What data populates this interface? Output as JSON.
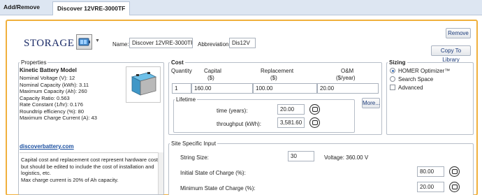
{
  "tab": {
    "label": "Add/Remove",
    "active": "Discover 12VRE-3000TF"
  },
  "header": {
    "title": "STORAGE",
    "name_label": "Name:",
    "name_value": "Discover 12VRE-3000TF",
    "abbr_label": "Abbreviation:",
    "abbr_value": "Dis12V",
    "remove_label": "Remove",
    "library_label": "Copy To Library"
  },
  "properties": {
    "title": "Properties",
    "model": "Kinetic Battery Model",
    "lines": [
      "Nominal Voltage (V): 12",
      "Nominal Capacity (kWh): 3.11",
      "Maximum Capacity (Ah): 260",
      "Capacity Ratio: 0.563",
      "Rate Constant (1/hr): 0.176",
      "Roundtrip efficiency (%): 80",
      "Maximum Charge Current (A): 43"
    ],
    "link": "discoverbattery.com",
    "note_lines": [
      "Capital cost and replacement cost represent hardware costs,",
      "but should be edited to include the cost of installation and",
      "logistics, etc.",
      "Max charge current is 20% of Ah capacity."
    ]
  },
  "cost": {
    "title": "Cost",
    "headers": {
      "quantity": "Quantity",
      "capital": "Capital",
      "capital_unit": "($)",
      "replacement": "Replacement",
      "replacement_unit": "($)",
      "om": "O&M",
      "om_unit": "($/year)"
    },
    "row": {
      "quantity": "1",
      "capital": "160.00",
      "replacement": "100.00",
      "om": "20.00"
    },
    "lifetime_title": "Lifetime",
    "time_label": "time (years):",
    "time_value": "20.00",
    "throughput_label": "throughput (kWh):",
    "throughput_value": "3,581.60",
    "more_label": "More..."
  },
  "sizing": {
    "title": "Sizing",
    "options": [
      "HOMER Optimizer™",
      "Search Space"
    ],
    "advanced": "Advanced"
  },
  "site": {
    "title": "Site Specific Input",
    "string_label": "String Size:",
    "string_value": "30",
    "voltage_label": "Voltage: 360.00 V",
    "initial_label": "Initial State of Charge (%):",
    "initial_value": "80.00",
    "minimum_label": "Minimum State of Charge (%):",
    "minimum_value": "20.00"
  },
  "colors": {
    "accent_border": "#f0b03c",
    "title_navy": "#1a2a66",
    "link_blue": "#1a4fa0"
  }
}
